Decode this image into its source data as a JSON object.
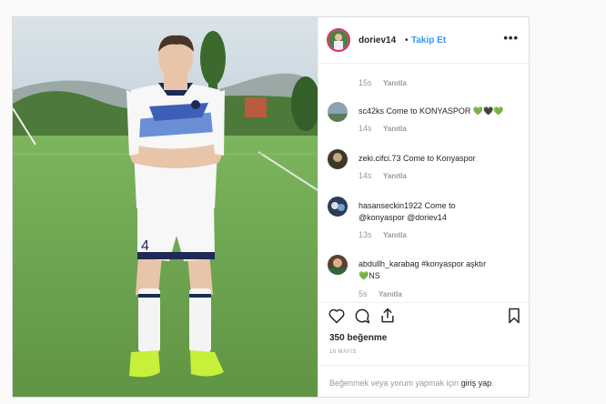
{
  "post": {
    "username": "doriev14",
    "separator": "•",
    "follow_label": "Takip Et",
    "more_icon": "more-icon",
    "photo_alt": "",
    "comments": [
      {
        "user": "",
        "text": "",
        "time": "15s",
        "reply": "Yanıtla"
      },
      {
        "user": "sc42ks",
        "text": "Come to KONYASPOR 💚🖤💚",
        "time": "14s",
        "reply": "Yanıtla"
      },
      {
        "user": "zeki.cifci.73",
        "text": "Come to Konyaspor",
        "time": "14s",
        "reply": "Yanıtla"
      },
      {
        "user": "hasanseckin1922",
        "text": "Come to @konyaspor @doriev14",
        "time": "13s",
        "reply": "Yanıtla"
      },
      {
        "user": "abdullh_karabag",
        "text": "#konyaspor aşktır 💚NS",
        "time": "5s",
        "reply": "Yanıtla"
      }
    ],
    "likes": "350 beğenme",
    "date": "16 MAYIS",
    "footer_prefix": "Beğenmek veya yorum yapmak için ",
    "footer_link": "giriş yap",
    "footer_suffix": ".",
    "colors": {
      "link": "#3897f0",
      "muted": "#999999",
      "border": "#dbdbdb"
    }
  }
}
